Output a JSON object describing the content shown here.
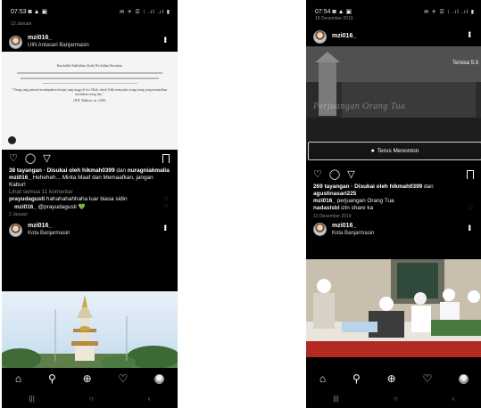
{
  "left": {
    "status": {
      "time": "07:53",
      "icons": "◙ ▲ ▣",
      "right_icons": "✉ ✈ ☰ ⁝ .ıl .ıl ▮"
    },
    "date_caption": "13 Januari",
    "post1": {
      "author": "mzi016_",
      "location": "UIN Antasari Banjarmasin",
      "image_text": {
        "greeting": "Rasulullah Shallallahu Alaihi Wa Sallam Bersabda,",
        "quote": "\"Orang yang pemaaf mendapatkan derajat yang tinggi di sisi Allah, sebab Allah menyukai orang-orang yang memaafkan kesalahan orang lain.\"",
        "source": "(H.R. Bukhari, no. 2449)"
      },
      "likes": "38 tayangan · Disukai oleh",
      "liker1": "hikmah0399",
      "and": "dan",
      "liker2": "nuragniakmalia",
      "caption_user": "mzi016_",
      "caption": "Heheheh... Minta Maaf dan Memaafkan, jangan Kabur!",
      "view_comments": "Lihat semua 11 komentar",
      "comment1_user": "prayudagusti",
      "comment1": "hahahahahhaha luar biasa sidin",
      "comment2_user": "mzi016_",
      "comment2": "@prayudagusti 💚",
      "time_ago": "2 Januari"
    },
    "post2": {
      "author": "mzi016_",
      "location": "Kota Banjarmasin"
    },
    "nav": {
      "home": "⌂",
      "search": "🔍",
      "add": "⊕",
      "heart": "♡"
    },
    "sys": {
      "recent": "|||",
      "home": "○",
      "back": "‹"
    }
  },
  "right": {
    "status": {
      "time": "07:54",
      "icons": "◙ ▲ ▣",
      "right_icons": "✉ ✈ ☰ ⁝ .ıl .ıl ▮"
    },
    "date_caption": "18 Desember 2019",
    "post1": {
      "author": "mzi016_",
      "remaining": "Tersisa 5:3",
      "video_caption": "Perjuangan Orang Tua",
      "watch_label": "Terus Menonton",
      "likes": "269 tayangan · Disukai oleh",
      "liker1": "hikmah0399",
      "and": "dan",
      "liker2": "agustinasari225",
      "caption_user": "mzi016_",
      "caption": "perjuangan Orang Tua",
      "comment1_user": "nadaslsbl",
      "comment1": "izin share ka",
      "time_ago": "12 Desember 2019"
    },
    "post2": {
      "author": "mzi016_",
      "location": "Kota Banjarmasin"
    },
    "nav": {
      "home": "⌂",
      "search": "🔍",
      "add": "⊕",
      "heart": "♡"
    },
    "sys": {
      "recent": "|||",
      "home": "○",
      "back": "‹"
    }
  }
}
